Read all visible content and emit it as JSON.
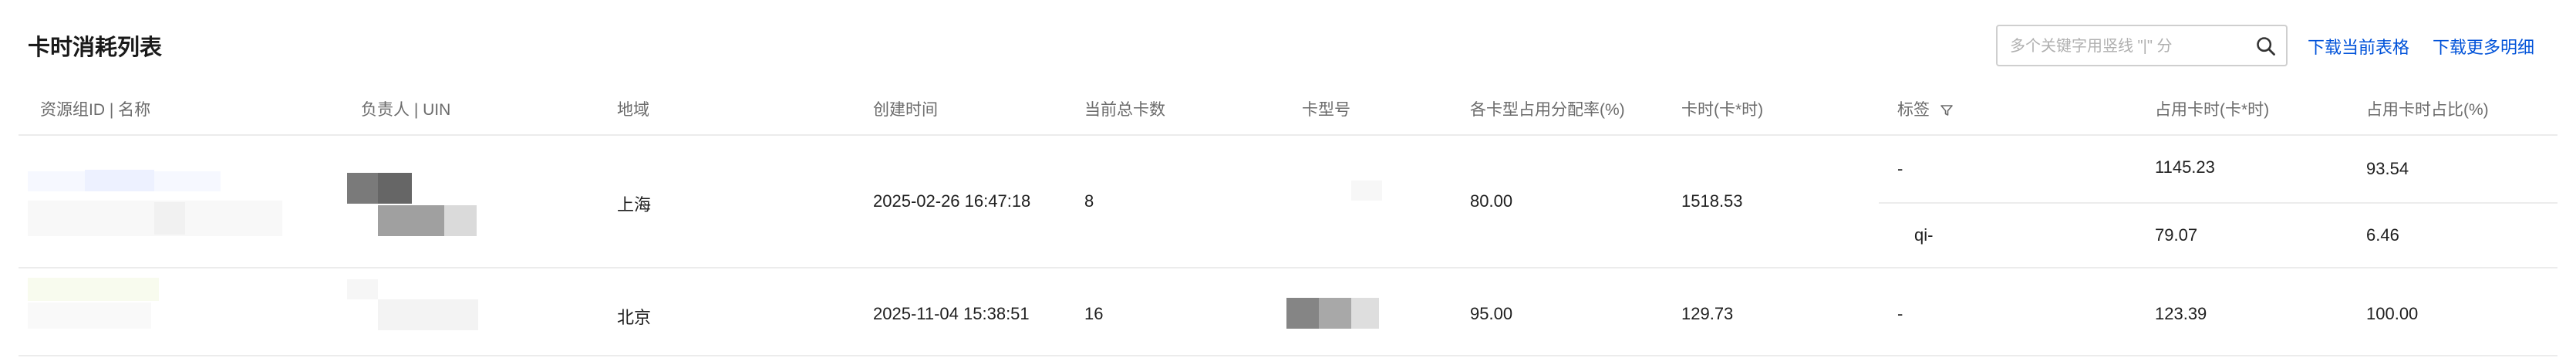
{
  "page": {
    "title": "卡时消耗列表",
    "search_placeholder": "多个关键字用竖线 \"|\" 分",
    "download_current": "下载当前表格",
    "download_more": "下载更多明细"
  },
  "table": {
    "headers": [
      "资源组ID | 名称",
      "负责人 | UIN",
      "地域",
      "创建时间",
      "当前总卡数",
      "卡型号",
      "各卡型占用分配率(%)",
      "卡时(卡*时)",
      "标签",
      "占用卡时(卡*时)",
      "占用卡时占比(%)"
    ],
    "rows": [
      {
        "region": "上海",
        "created": "2025-02-26 16:47:18",
        "total_cards": "8",
        "alloc_rate": "80.00",
        "card_hours": "1518.53",
        "tags": [
          {
            "tag": "-",
            "used_hours": "1145.23",
            "ratio": "93.54"
          },
          {
            "tag": "qi-",
            "used_hours": "79.07",
            "ratio": "6.46"
          }
        ]
      },
      {
        "region": "北京",
        "created": "2025-11-04 15:38:51",
        "total_cards": "16",
        "alloc_rate": "95.00",
        "card_hours": "129.73",
        "tags": [
          {
            "tag": "-",
            "used_hours": "123.39",
            "ratio": "100.00"
          }
        ]
      }
    ]
  },
  "colors": {
    "link": "#0052d9",
    "header_text": "#6b6b6b",
    "divider": "#ececec"
  },
  "icons": {
    "search": "search-icon",
    "filter": "filter-icon"
  }
}
